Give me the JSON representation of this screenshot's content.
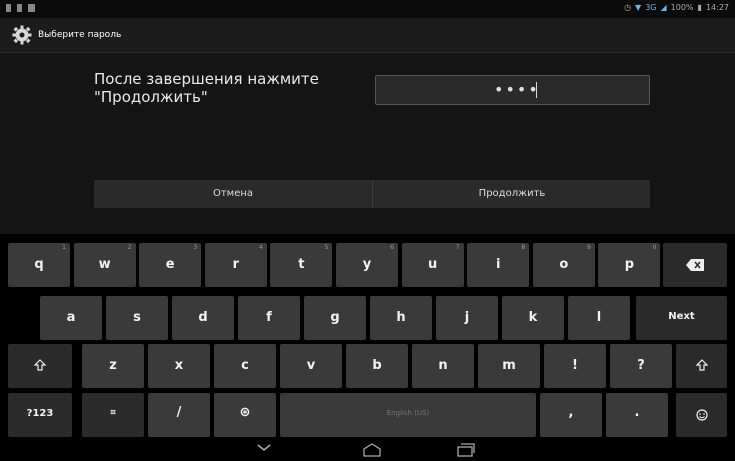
{
  "status": {
    "time": "14:27",
    "battery": "100%",
    "network": "3G"
  },
  "title": "Выберите пароль",
  "prompt": "После завершения нажмите \"Продолжить\"",
  "password": {
    "masked": "••••"
  },
  "buttons": {
    "cancel": "Отмена",
    "continue": "Продолжить"
  },
  "keyboard": {
    "row1": [
      {
        "k": "q",
        "h": "1"
      },
      {
        "k": "w",
        "h": "2"
      },
      {
        "k": "e",
        "h": "3"
      },
      {
        "k": "r",
        "h": "4"
      },
      {
        "k": "t",
        "h": "5"
      },
      {
        "k": "y",
        "h": "6"
      },
      {
        "k": "u",
        "h": "7"
      },
      {
        "k": "i",
        "h": "8"
      },
      {
        "k": "o",
        "h": "9"
      },
      {
        "k": "p",
        "h": "0"
      }
    ],
    "row2": [
      "a",
      "s",
      "d",
      "f",
      "g",
      "h",
      "j",
      "k",
      "l"
    ],
    "row3": [
      "z",
      "x",
      "c",
      "v",
      "b",
      "n",
      "m",
      "!",
      "?"
    ],
    "next": "Next",
    "symbols": "?123",
    "slash": "/",
    "comma": ",",
    "period": ".",
    "space": "English (US)"
  },
  "icons": {
    "settings": "gear-icon",
    "backspace": "backspace-icon",
    "shift": "shift-icon",
    "emoji": "emoji-icon",
    "settings_key": "keyboard-settings-icon",
    "globe": "globe-icon"
  }
}
